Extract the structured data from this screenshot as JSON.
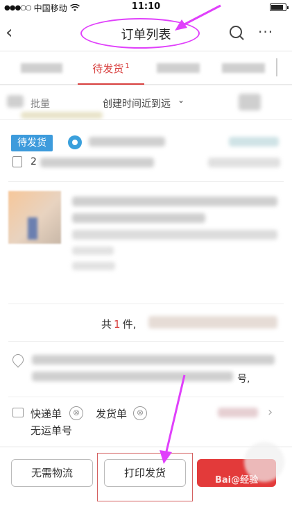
{
  "statusbar": {
    "carrier": "中国移动",
    "signal_dots": "●●●○○",
    "time": "11:10",
    "battery_level": 0.85
  },
  "navbar": {
    "back_glyph": "‹",
    "title": "订单列表",
    "more_glyph": "···"
  },
  "tabs": {
    "active_label": "待发货",
    "active_count": "1"
  },
  "filter": {
    "batch_label": "批量",
    "sort_label": "创建时间近到远",
    "sort_chevron": "⌄"
  },
  "order": {
    "status_badge": "待发货",
    "order_no_prefix": "2",
    "total_prefix": "共",
    "total_count": "1",
    "total_suffix": "件,",
    "address_tail": "号,",
    "waybill_label": "快递单",
    "shipping_label": "发货单",
    "no_tracking": "无运单号",
    "remove_glyph": "⊗"
  },
  "actions": {
    "no_logistics": "无需物流",
    "print_ship": "打印发货",
    "watermark": "Bai@经验"
  },
  "colors": {
    "accent": "#d8403f",
    "badge": "#3d9bdc",
    "annotation": "#e040fb"
  }
}
